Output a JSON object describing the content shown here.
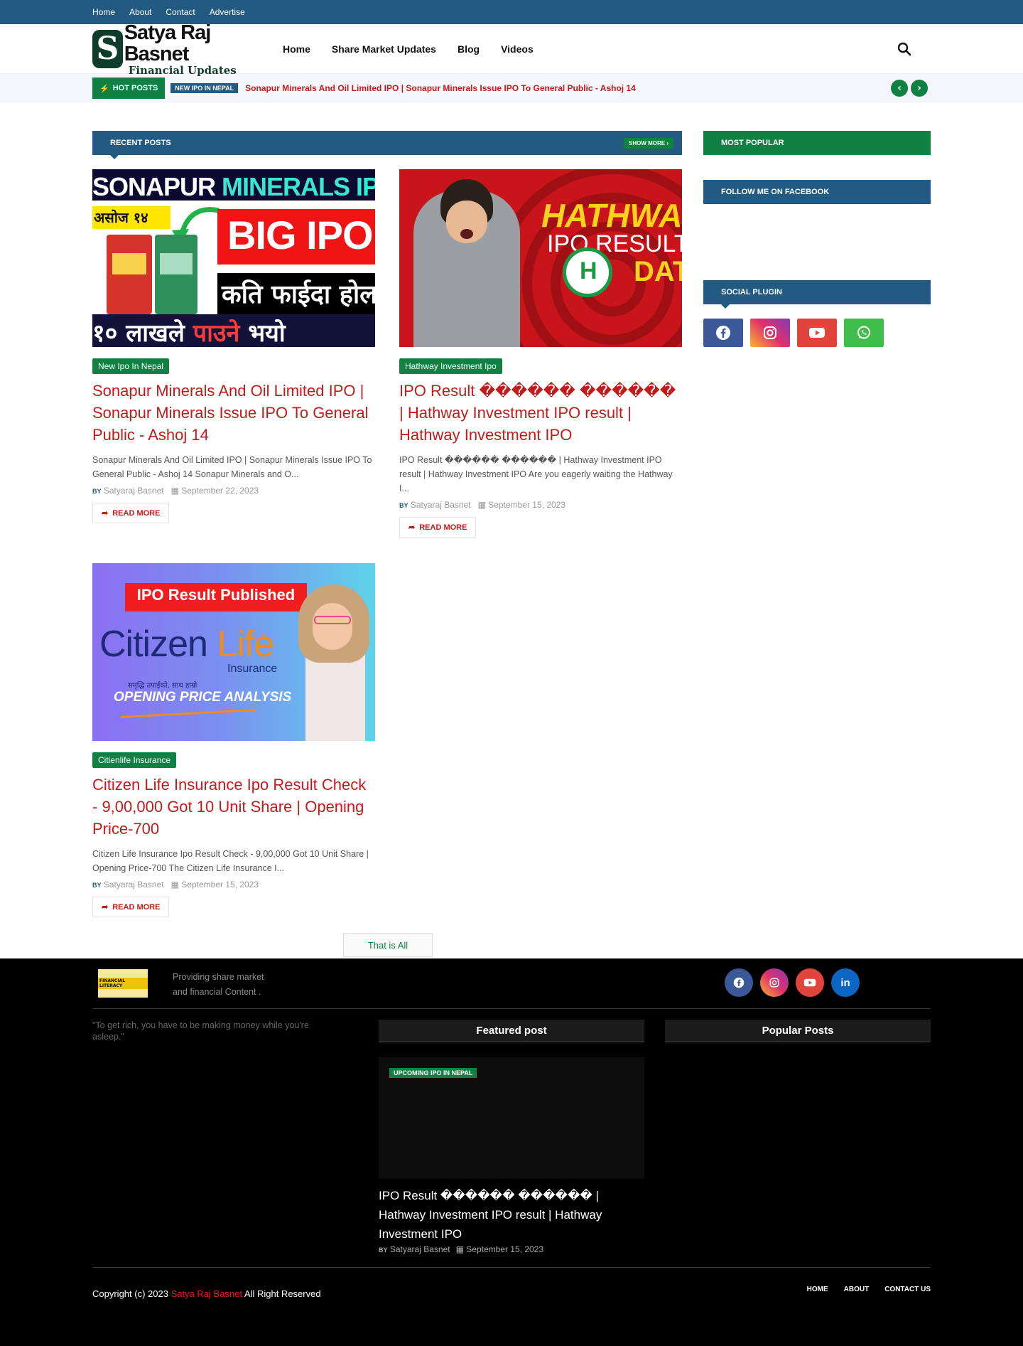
{
  "topbar": {
    "links": [
      "Home",
      "About",
      "Contact",
      "Advertise"
    ]
  },
  "header": {
    "logo_line1": "Satya Raj Basnet",
    "logo_line2": "Financial Updates",
    "logo_letter": "S",
    "nav": [
      "Home",
      "Share Market Updates",
      "Blog",
      "Videos"
    ]
  },
  "hot": {
    "label": "HOT POSTS",
    "tag": "NEW IPO IN NEPAL",
    "title": "Sonapur Minerals And Oil Limited IPO | Sonapur Minerals Issue IPO To General Public - Ashoj 14"
  },
  "recent": {
    "heading": "RECENT POSTS",
    "show_more": "SHOW MORE",
    "read_more": "READ MORE",
    "by": "BY",
    "posts": [
      {
        "label": "New Ipo In Nepal",
        "title": "Sonapur Minerals And Oil Limited IPO | Sonapur Minerals Issue IPO To General Public - Ashoj 14",
        "snippet": "Sonapur Minerals And Oil Limited IPO | Sonapur Minerals Issue IPO To General Public - Ashoj 14 Sonapur Minerals and O...",
        "author": "Satyaraj Basnet",
        "date": "September 22, 2023",
        "thumb": {
          "line1a": "SONAPUR ",
          "line1b": "MINERALS IPO",
          "ashoj": "असोज १४",
          "big": "BIG IPO",
          "kati": "कति फाईदा होला",
          "bottom_a": "१० लाखले ",
          "bottom_b": "पाउने",
          "bottom_c": " भयो"
        }
      },
      {
        "label": "Hathway Investment Ipo",
        "title": "IPO Result ������ ������ | Hathway Investment IPO result | Hathway Investment IPO",
        "snippet": "IPO Result ������ ������ | Hathway Investment IPO result | Hathway Investment IPO Are you eagerly waiting the Hathway I...",
        "author": "Satyaraj Basnet",
        "date": "September 15, 2023",
        "thumb": {
          "hathway": "HATHWAY",
          "ipo_result": "IPO RESULT",
          "date": "DAT"
        }
      },
      {
        "label": "Citienlife Insurance",
        "title": "Citizen Life Insurance Ipo Result Check - 9,00,000 Got 10 Unit Share | Opening Price-700",
        "snippet": "Citizen Life Insurance Ipo Result Check - 9,00,000 Got 10 Unit Share | Opening Price-700 The Citizen Life Insurance I...",
        "author": "Satyaraj Basnet",
        "date": "September 15, 2023",
        "thumb": {
          "banner": "IPO Result Published",
          "citizen": "Citizen",
          "life": "Life",
          "insurance": "Insurance",
          "tagline": "समृद्धि तपाईंको, साथ हाम्रो",
          "opening": "OPENING PRICE  ANALYSIS"
        }
      }
    ],
    "end_label": "That is All"
  },
  "sidebar": {
    "popular": "MOST POPULAR",
    "facebook": "FOLLOW ME ON FACEBOOK",
    "social": "SOCIAL PLUGIN",
    "social_icons": [
      "facebook-icon",
      "instagram-icon",
      "youtube-icon",
      "whatsapp-icon"
    ]
  },
  "footer": {
    "logo_text": "FINANCIAL LITERACY",
    "desc": "Providing share market and financial Content .",
    "social_icons": [
      "facebook-icon",
      "instagram-icon",
      "youtube-icon",
      "linkedin-icon"
    ],
    "quote": "\"To get rich, you have to be making money while you're asleep.\"",
    "featured_head": "Featured post",
    "popular_head": "Popular Posts",
    "featured_tag": "UPCOMING IPO IN NEPAL",
    "featured_title": "IPO Result ������ ������ | Hathway Investment IPO result | Hathway Investment IPO",
    "featured_by": "BY",
    "featured_author": "Satyaraj Basnet",
    "featured_date": "September 15, 2023",
    "copyright_pre": "Copyright (c) 2023 ",
    "copyright_name": "Satya Raj Basnet",
    "copyright_post": " All Right Reserved",
    "links": [
      "HOME",
      "ABOUT",
      "CONTACT US"
    ]
  },
  "colors": {
    "primary_blue": "#225a82",
    "accent_green": "#108043",
    "title_red": "#c31a1a"
  }
}
